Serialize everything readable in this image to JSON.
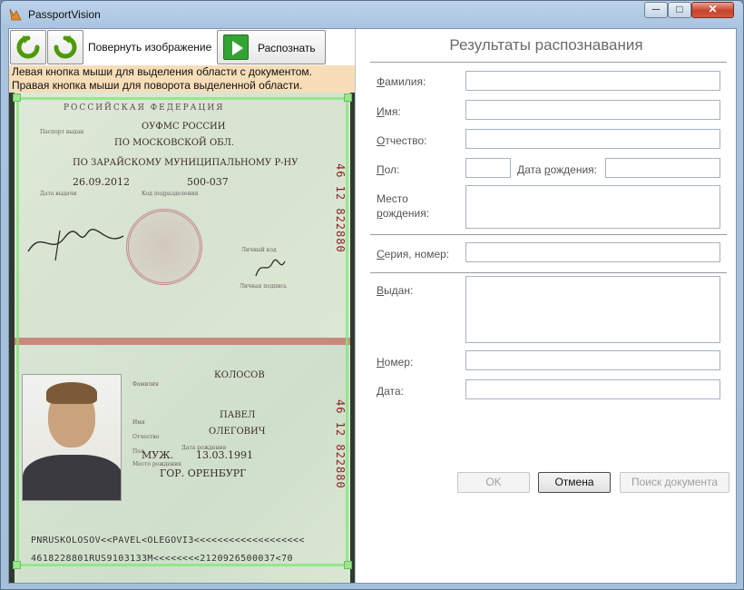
{
  "window": {
    "title": "PassportVision",
    "min_glyph": "─",
    "max_glyph": "□",
    "close_glyph": "✕"
  },
  "toolbar": {
    "rotate_left_icon": "rotate-left-icon",
    "rotate_right_icon": "rotate-right-icon",
    "rotate_label": "Повернуть изображение",
    "recognize_label": "Распознать"
  },
  "hint": {
    "line1": "Левая кнопка мыши для выделения области с документом.",
    "line2": "Правая кнопка мыши для поворота выделенной области."
  },
  "passport": {
    "header": "РОССИЙСКАЯ   ФЕДЕРАЦИЯ",
    "issued_by_label": "Паспорт выдан",
    "issued_by_1": "ОУФМС РОССИИ",
    "issued_by_2": "ПО МОСКОВСКОЙ ОБЛ.",
    "issued_by_3": "ПО ЗАРАЙСКОМУ МУНИЦИПАЛЬНОМУ Р-НУ",
    "issue_date": "26.09.2012",
    "dept_code": "500-037",
    "issue_date_label": "Дата выдачи",
    "dept_code_label": "Код подразделения",
    "personal_code_label": "Личный код",
    "holder_sign_label": "Личная подпись",
    "serial_vertical": "46  12  822880",
    "surname_label": "Фамилия",
    "surname": "КОЛОСОВ",
    "name_label": "Имя",
    "name": "ПАВЕЛ",
    "patronymic_label": "Отчество",
    "patronymic": "ОЛЕГОВИЧ",
    "sex_label": "Пол",
    "sex": "МУЖ.",
    "dob_label": "Дата рождения",
    "dob": "13.03.1991",
    "birthplace_label": "Место рождения",
    "birthplace": "ГОР. ОРЕНБУРГ",
    "mrz_1": "PNRUSKOLOSOV<<PAVEL<OLEGOVI3<<<<<<<<<<<<<<<<<<<",
    "mrz_2": "4618228801RUS9103133M<<<<<<<<2120926500037<70"
  },
  "results": {
    "title": "Результаты распознавания",
    "surname_label_u": "Ф",
    "surname_label_rest": "амилия:",
    "name_label_u": "И",
    "name_label_rest": "мя:",
    "patronymic_label_u": "О",
    "patronymic_label_rest": "тчество:",
    "sex_label_u": "П",
    "sex_label_rest": "ол:",
    "dob_label_pre": "Дата ",
    "dob_label_u": "р",
    "dob_label_rest": "ождения:",
    "birthplace_label_1": "Место",
    "birthplace_label_2_u": "р",
    "birthplace_label_2_rest": "ождения:",
    "series_label_u": "С",
    "series_label_rest": "ерия, номер:",
    "issued_label_u": "В",
    "issued_label_rest": "ыдан:",
    "number_label_u": "Н",
    "number_label_rest": "омер:",
    "date_label_u": "Д",
    "date_label_rest": "ата:",
    "values": {
      "surname": "",
      "name": "",
      "patronymic": "",
      "sex": "",
      "dob": "",
      "birthplace": "",
      "series": "",
      "issued": "",
      "number": "",
      "date": ""
    }
  },
  "buttons": {
    "ok": "OK",
    "cancel": "Отмена",
    "search": "Поиск документа"
  }
}
